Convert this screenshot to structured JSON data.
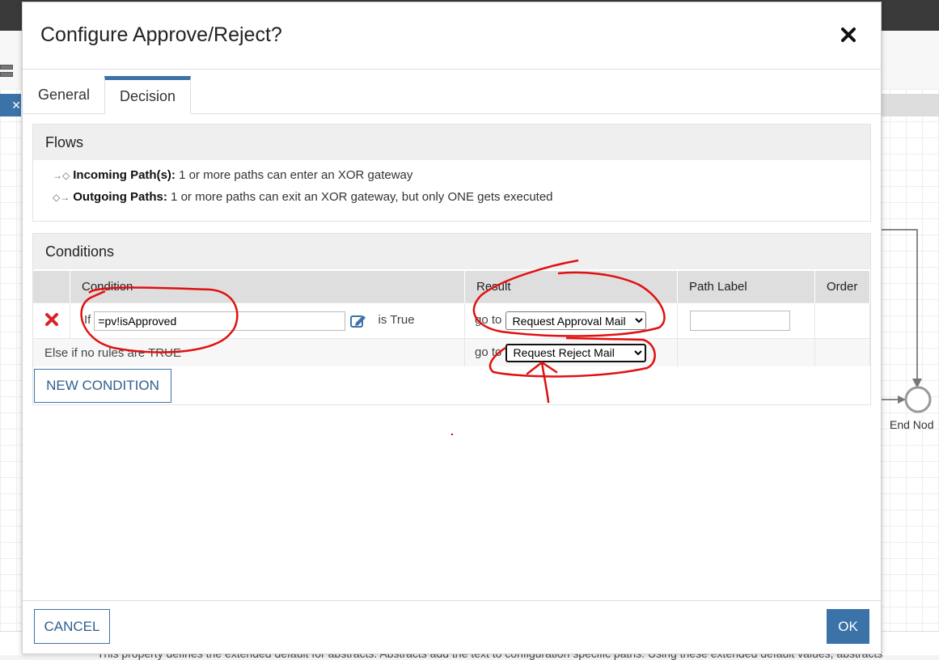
{
  "background": {
    "end_node_label": "End Nod",
    "bottom_text": "This property defines the extended default for abstracts. Abstracts add the text to configuration specific paths. Using these extended default values, abstracts"
  },
  "dialog": {
    "title": "Configure Approve/Reject?",
    "close_label": "✖",
    "tabs": [
      {
        "label": "General",
        "active": false
      },
      {
        "label": "Decision",
        "active": true
      }
    ]
  },
  "flows": {
    "heading": "Flows",
    "items": [
      {
        "label": "Incoming Path(s):",
        "text": " 1 or more paths can enter an XOR gateway"
      },
      {
        "label": "Outgoing Paths:",
        "text": " 1 or more paths can exit an XOR gateway, but only ONE gets executed"
      }
    ]
  },
  "conditions": {
    "heading": "Conditions",
    "columns": [
      "Condition",
      "Result",
      "Path Label",
      "Order"
    ],
    "rows": [
      {
        "if_label": "If",
        "expression": "=pv!isApproved",
        "is_true_label": "is True",
        "goto_label": "go to",
        "result": "Request Approval Mail",
        "path_label": ""
      }
    ],
    "else_row": {
      "text": "Else if no rules are TRUE",
      "goto_label": "go to",
      "result": "Request Reject Mail"
    },
    "new_condition_label": "NEW CONDITION"
  },
  "footer": {
    "cancel_label": "CANCEL",
    "ok_label": "OK"
  },
  "colors": {
    "accent": "#3b73a8",
    "delete": "#d8232a",
    "annotation": "#e01010"
  }
}
